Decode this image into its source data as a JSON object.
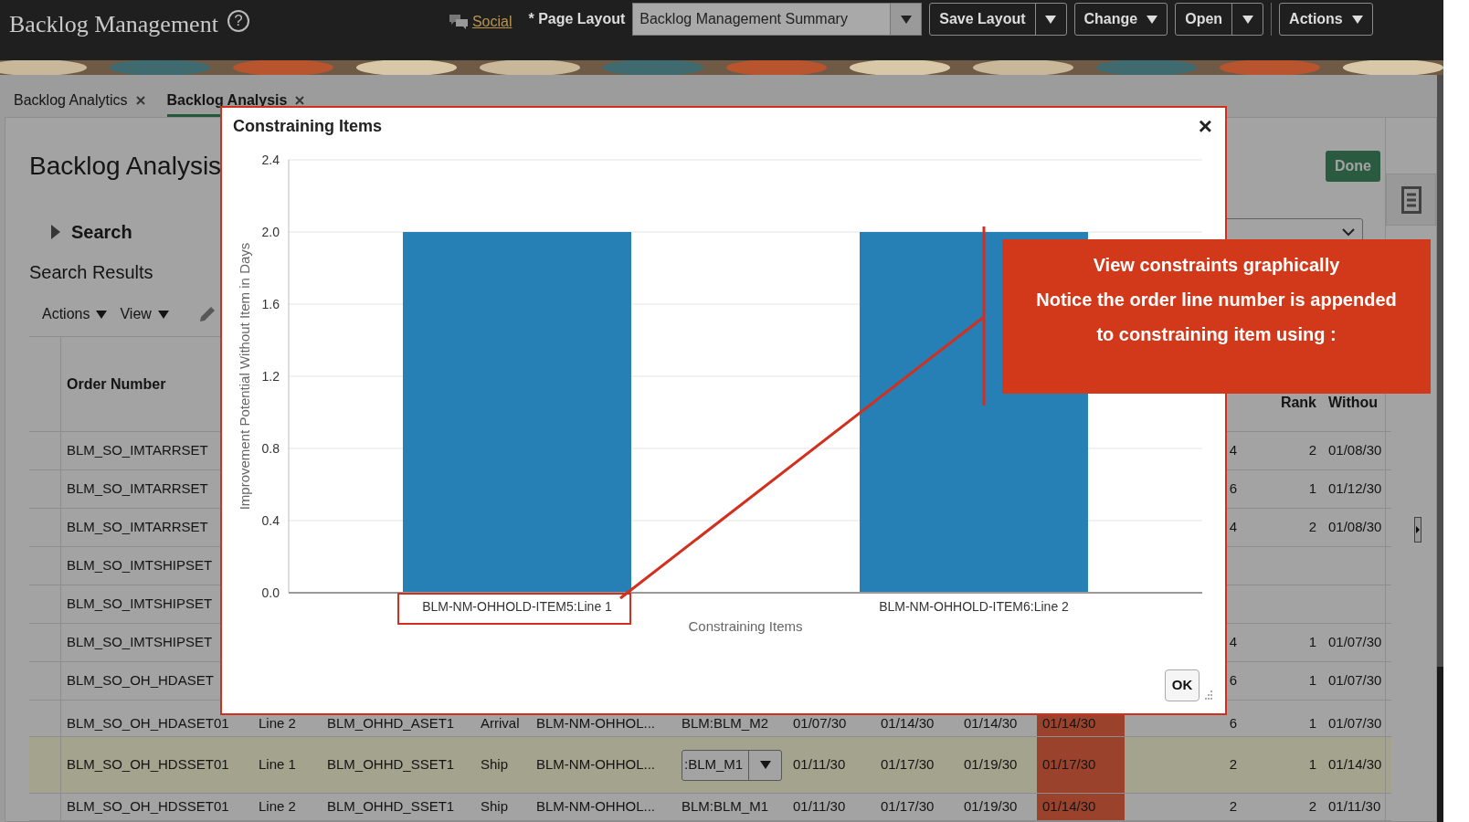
{
  "header": {
    "title": "Backlog Management",
    "help": "?",
    "social": "Social",
    "page_layout_label": "* Page Layout",
    "layout_select": "Backlog Management Summary",
    "buttons": [
      {
        "label": "Save Layout",
        "kind": "split"
      },
      {
        "label": "Change",
        "kind": "menu"
      },
      {
        "label": "Open",
        "kind": "split"
      },
      {
        "label": "Actions",
        "kind": "menu"
      }
    ]
  },
  "tabs": [
    {
      "label": "Backlog Analytics",
      "selected": false
    },
    {
      "label": "Backlog Analysis",
      "selected": true
    }
  ],
  "page": {
    "title": "Backlog Analysis",
    "done_button": "Done",
    "search": {
      "label": "Search",
      "expanded": false
    },
    "results_title": "Search Results",
    "toolbar": [
      "Actions",
      "View"
    ]
  },
  "table": {
    "headers": {
      "order_number": "Order Number",
      "rank": "Rank",
      "column_14": "Withou"
    },
    "rows": [
      {
        "order_number": "BLM_SO_IMTARRSET",
        "column_12": "4",
        "rank": "2",
        "column_14": "01/08/30",
        "selected": false
      },
      {
        "order_number": "BLM_SO_IMTARRSET",
        "column_12": "6",
        "rank": "1",
        "column_14": "01/12/30",
        "selected": false
      },
      {
        "order_number": "BLM_SO_IMTARRSET",
        "column_12": "4",
        "rank": "2",
        "column_14": "01/08/30",
        "selected": false
      },
      {
        "order_number": "BLM_SO_IMTSHIPSET",
        "selected": false
      },
      {
        "order_number": "BLM_SO_IMTSHIPSET",
        "selected": false
      },
      {
        "order_number": "BLM_SO_IMTSHIPSET",
        "column_12": "4",
        "rank": "1",
        "column_14": "01/07/30",
        "selected": false
      },
      {
        "order_number": "BLM_SO_OH_HDASET",
        "column_12": "6",
        "rank": "1",
        "column_14": "01/07/30",
        "selected": false
      },
      {
        "order_number": "BLM_SO_OH_HDASET01",
        "column_2": "Line 2",
        "column_3": "BLM_OHHD_ASET1",
        "column_4": "Arrival",
        "column_5": "BLM-NM-OHHOL...",
        "column_6": "BLM:BLM_M2",
        "column_7": "01/07/30",
        "column_8": "01/14/30",
        "column_9": "01/14/30",
        "column_10": "01/14/30",
        "column_12": "6",
        "rank": "1",
        "column_14": "01/07/30",
        "selected": false,
        "flagged": true
      },
      {
        "order_number": "BLM_SO_OH_HDSSET01",
        "column_2": "Line 1",
        "column_3": "BLM_OHHD_SSET1",
        "column_4": "Ship",
        "column_5": "BLM-NM-OHHOL...",
        "column_6": ":BLM_M1",
        "column_7": "01/11/30",
        "column_8": "01/17/30",
        "column_9": "01/19/30",
        "column_10": "01/17/30",
        "column_12": "2",
        "rank": "1",
        "column_14": "01/14/30",
        "selected": true,
        "flagged": true
      },
      {
        "order_number": "BLM_SO_OH_HDSSET01",
        "column_2": "Line 2",
        "column_3": "BLM_OHHD_SSET1",
        "column_4": "Ship",
        "column_5": "BLM-NM-OHHOL...",
        "column_6": "BLM:BLM_M1",
        "column_7": "01/11/30",
        "column_8": "01/17/30",
        "column_9": "01/19/30",
        "column_10": "01/14/30",
        "column_12": "2",
        "rank": "2",
        "column_14": "01/11/30",
        "selected": false,
        "flagged": true
      }
    ]
  },
  "dialog": {
    "title": "Constraining Items",
    "close": "×",
    "ok_button": "OK",
    "chart_data": {
      "type": "bar",
      "xlabel": "Constraining Items",
      "ylabel": "Improvement Potential Without Item in Days",
      "categories": [
        "BLM-NM-OHHOLD-ITEM5:Line 1",
        "BLM-NM-OHHOLD-ITEM6:Line 2"
      ],
      "series": [
        {
          "color": "#267fb5",
          "values": [
            2.0,
            2.0
          ]
        }
      ],
      "grid": true,
      "ylim": [
        0,
        2.4
      ],
      "yticks": [
        {
          "value": 0,
          "label": "0.0"
        },
        {
          "value": 0.4,
          "label": "0.4"
        },
        {
          "value": 0.8,
          "label": "0.8"
        },
        {
          "value": 1.2,
          "label": "1.2"
        },
        {
          "value": 1.6,
          "label": "1.6"
        },
        {
          "value": 2.0,
          "label": "2.0"
        },
        {
          "value": 2.4,
          "label": "2.4"
        }
      ]
    }
  },
  "callout": {
    "lines": [
      "View constraints graphically",
      "Notice the order line number is appended",
      "to constraining item using :"
    ]
  }
}
